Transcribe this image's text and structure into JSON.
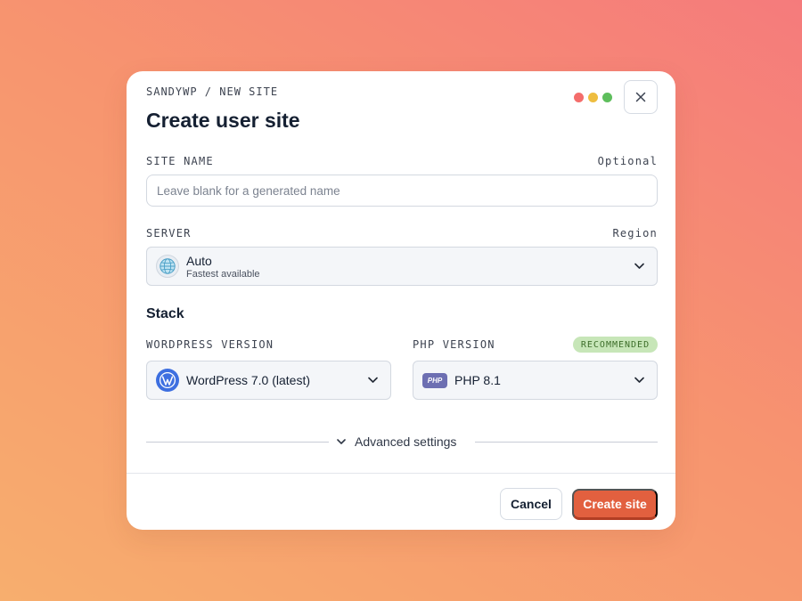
{
  "breadcrumb": "SANDYWP / NEW SITE",
  "title": "Create user site",
  "window_dots": [
    "#f46d6b",
    "#eebd3f",
    "#5ebe5c"
  ],
  "close_icon": "close-icon",
  "site_name": {
    "label": "SITE NAME",
    "hint": "Optional",
    "placeholder": "Leave blank for a generated name",
    "value": ""
  },
  "server": {
    "label": "SERVER",
    "hint": "Region",
    "icon": "globe-icon",
    "selected": "Auto",
    "subtitle": "Fastest available"
  },
  "stack": {
    "title": "Stack",
    "wordpress": {
      "label": "WORDPRESS VERSION",
      "icon": "wordpress-icon",
      "selected": "WordPress 7.0 (latest)"
    },
    "php": {
      "label": "PHP VERSION",
      "badge": "RECOMMENDED",
      "icon_text": "PHP",
      "selected": "PHP 8.1"
    }
  },
  "advanced": {
    "label": "Advanced settings"
  },
  "footer": {
    "cancel_label": "Cancel",
    "create_label": "Create site"
  },
  "colors": {
    "accent": "#e2603f",
    "badge_bg": "#c7e6b8",
    "wordpress_blue": "#3d6fe0",
    "php_purple": "#6d6fb2"
  }
}
